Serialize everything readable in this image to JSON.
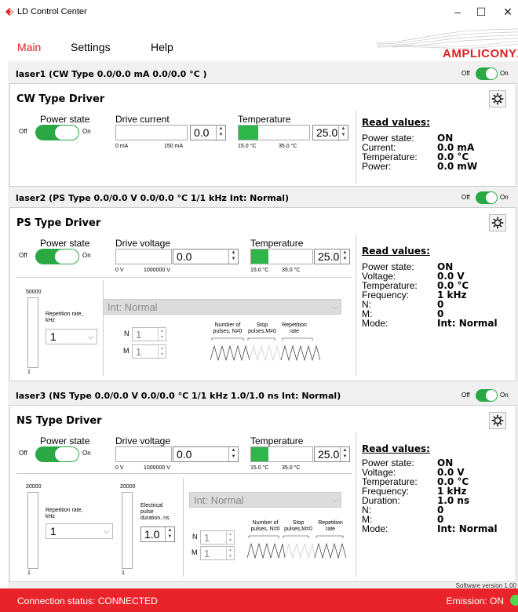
{
  "window": {
    "title": "LD Control Center",
    "minimize": "–",
    "maximize": "☐",
    "close": "✕"
  },
  "menu": [
    {
      "label": "Main",
      "active": true
    },
    {
      "label": "Settings"
    },
    {
      "label": "Help"
    }
  ],
  "brand": {
    "logo": "AMPLICONYX",
    "accent": "#d9201f"
  },
  "lasers": [
    {
      "header": "laser1 (CW Type 0.0/0.0 mA  0.0/0.0 °C )",
      "toggle_off": "Off",
      "toggle_on": "On",
      "title": "CW Type Driver",
      "power_state_label": "Power state",
      "ps_off": "Off",
      "ps_on": "On",
      "drive_label": "Drive current",
      "drive_value": "0.0",
      "drive_min": "0 mA",
      "drive_max": "150 mA",
      "temp_label": "Temperature",
      "temp_value": "25.0",
      "temp_min": "15.0 °C",
      "temp_max": "35.0 °C",
      "temp_fill_fraction": 0.28,
      "read_title": "Read values:",
      "read": [
        {
          "k": "Power state:",
          "v": "ON"
        },
        {
          "k": "Current:",
          "v": "0.0 mA"
        },
        {
          "k": "Temperature:",
          "v": "0.0 °C"
        },
        {
          "k": "Power:",
          "v": "0.0 mW"
        }
      ]
    },
    {
      "header": "laser2 (PS Type 0.0/0.0 V  0.0/0.0 °C  1/1 kHz  Int: Normal)",
      "toggle_off": "Off",
      "toggle_on": "On",
      "title": "PS Type Driver",
      "power_state_label": "Power state",
      "ps_off": "Off",
      "ps_on": "On",
      "drive_label": "Drive voltage",
      "drive_value": "0.0",
      "drive_min": "0 V",
      "drive_max": "1000000 V",
      "temp_label": "Temperature",
      "temp_value": "25.0",
      "temp_min": "15.0 °C",
      "temp_max": "35.0 °C",
      "temp_fill_fraction": 0.28,
      "rep_max": "50000",
      "rep_min": "1",
      "rep_label": "Repetition rate,\nkHz",
      "rep_value": "1",
      "mode_value": "Int: Normal",
      "n_label": "N",
      "n_value": "1",
      "m_label": "M",
      "m_value": "1",
      "pulse_labels": [
        "Number of\npulses, N≠0",
        "Stop\npulses,M≠0",
        "Repetition\nrate"
      ],
      "read_title": "Read values:",
      "read": [
        {
          "k": "Power state:",
          "v": "ON"
        },
        {
          "k": "Voltage:",
          "v": "0.0 V"
        },
        {
          "k": "Temperature:",
          "v": "0.0 °C"
        },
        {
          "k": "Frequency:",
          "v": "1 kHz"
        },
        {
          "k": "N:",
          "v": "0"
        },
        {
          "k": "M:",
          "v": "0"
        },
        {
          "k": "Mode:",
          "v": "Int: Normal"
        }
      ]
    },
    {
      "header": "laser3 (NS Type 0.0/0.0 V  0.0/0.0 °C  1/1 kHz  1.0/1.0 ns  Int: Normal)",
      "toggle_off": "Off",
      "toggle_on": "On",
      "title": "NS Type Driver",
      "power_state_label": "Power state",
      "ps_off": "Off",
      "ps_on": "On",
      "drive_label": "Drive voltage",
      "drive_value": "0.0",
      "drive_min": "0 V",
      "drive_max": "1000000 V",
      "temp_label": "Temperature",
      "temp_value": "25.0",
      "temp_min": "15.0 °C",
      "temp_max": "35.0 °C",
      "temp_fill_fraction": 0.28,
      "rep_max": "20000",
      "rep_min": "1",
      "rep_label": "Repetition rate,\nkHz",
      "rep_value": "1",
      "dur_max": "20000",
      "dur_min": "1",
      "dur_label": "Electrical\npulse\nduration, ns",
      "dur_value": "1.0",
      "mode_value": "Int: Normal",
      "n_label": "N",
      "n_value": "1",
      "m_label": "M",
      "m_value": "1",
      "pulse_labels": [
        "Number of\npulses, N≠0",
        "Stop\npulses,M≠0",
        "Repetition\nrate"
      ],
      "read_title": "Read values:",
      "read": [
        {
          "k": "Power state:",
          "v": "ON"
        },
        {
          "k": "Voltage:",
          "v": "0.0 V"
        },
        {
          "k": "Temperature:",
          "v": "0.0 °C"
        },
        {
          "k": "Frequency:",
          "v": "1 kHz"
        },
        {
          "k": "Duration:",
          "v": "1.0 ns"
        },
        {
          "k": "N:",
          "v": "0"
        },
        {
          "k": "M:",
          "v": "0"
        },
        {
          "k": "Mode:",
          "v": "Int: Normal"
        }
      ]
    }
  ],
  "footer": {
    "version": "Software version 1.00",
    "connection": "Connection status: CONNECTED",
    "emission": "Emission: ON"
  },
  "colors": {
    "status_bar": "#e8232a",
    "toggle_green": "#29a844",
    "led_green": "#53d94f"
  }
}
